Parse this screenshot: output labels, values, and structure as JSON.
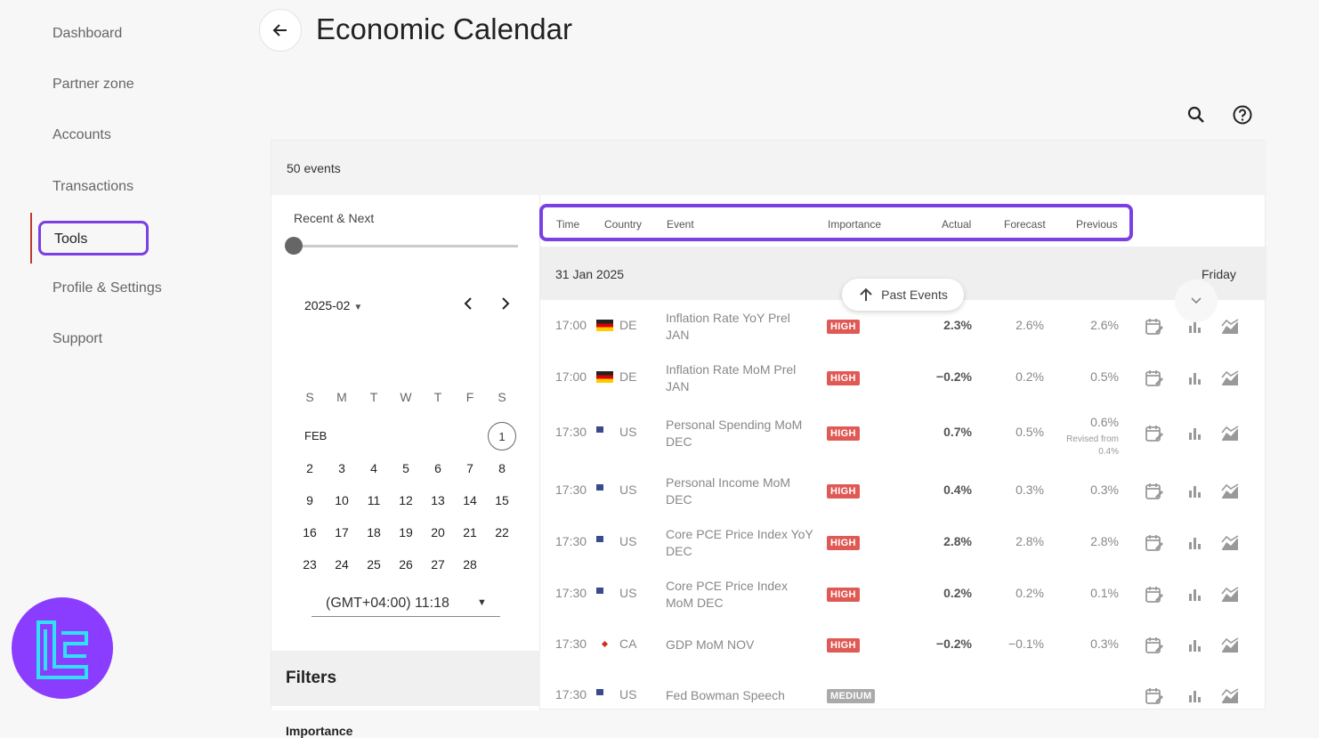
{
  "sidebar": {
    "items": [
      {
        "label": "Dashboard"
      },
      {
        "label": "Partner zone"
      },
      {
        "label": "Accounts"
      },
      {
        "label": "Transactions"
      },
      {
        "label": "Tools"
      },
      {
        "label": "Profile & Settings"
      },
      {
        "label": "Support"
      }
    ]
  },
  "header": {
    "title": "Economic Calendar"
  },
  "panel": {
    "events_count": "50 events",
    "range_label": "Recent & Next",
    "calendar": {
      "month_selector": "2025-02",
      "weekdays": [
        "S",
        "M",
        "T",
        "W",
        "T",
        "F",
        "S"
      ],
      "month_label": "FEB",
      "days": [
        "1",
        "2",
        "3",
        "4",
        "5",
        "6",
        "7",
        "8",
        "9",
        "10",
        "11",
        "12",
        "13",
        "14",
        "15",
        "16",
        "17",
        "18",
        "19",
        "20",
        "21",
        "22",
        "23",
        "24",
        "25",
        "26",
        "27",
        "28"
      ]
    },
    "timezone": "(GMT+04:00) 11:18",
    "filters_title": "Filters",
    "importance_label": "Importance"
  },
  "table": {
    "headers": {
      "time": "Time",
      "country": "Country",
      "event": "Event",
      "importance": "Importance",
      "actual": "Actual",
      "forecast": "Forecast",
      "previous": "Previous"
    },
    "date": "31 Jan 2025",
    "day": "Friday",
    "past_events_label": "Past Events",
    "rows": [
      {
        "time": "17:00",
        "flag": "de",
        "country": "DE",
        "event": "Inflation Rate YoY Prel JAN",
        "importance": "HIGH",
        "actual": "2.3%",
        "forecast": "2.6%",
        "previous": "2.6%",
        "revised": ""
      },
      {
        "time": "17:00",
        "flag": "de",
        "country": "DE",
        "event": "Inflation Rate MoM Prel JAN",
        "importance": "HIGH",
        "actual": "−0.2%",
        "forecast": "0.2%",
        "previous": "0.5%",
        "revised": ""
      },
      {
        "time": "17:30",
        "flag": "us",
        "country": "US",
        "event": "Personal Spending MoM DEC",
        "importance": "HIGH",
        "actual": "0.7%",
        "forecast": "0.5%",
        "previous": "0.6%",
        "revised": "Revised from 0.4%"
      },
      {
        "time": "17:30",
        "flag": "us",
        "country": "US",
        "event": "Personal Income MoM DEC",
        "importance": "HIGH",
        "actual": "0.4%",
        "forecast": "0.3%",
        "previous": "0.3%",
        "revised": ""
      },
      {
        "time": "17:30",
        "flag": "us",
        "country": "US",
        "event": "Core PCE Price Index YoY DEC",
        "importance": "HIGH",
        "actual": "2.8%",
        "forecast": "2.8%",
        "previous": "2.8%",
        "revised": ""
      },
      {
        "time": "17:30",
        "flag": "us",
        "country": "US",
        "event": "Core PCE Price Index MoM DEC",
        "importance": "HIGH",
        "actual": "0.2%",
        "forecast": "0.2%",
        "previous": "0.1%",
        "revised": ""
      },
      {
        "time": "17:30",
        "flag": "ca",
        "country": "CA",
        "event": "GDP MoM NOV",
        "importance": "HIGH",
        "actual": "−0.2%",
        "forecast": "−0.1%",
        "previous": "0.3%",
        "revised": ""
      },
      {
        "time": "17:30",
        "flag": "us",
        "country": "US",
        "event": "Fed Bowman Speech",
        "importance": "MEDIUM",
        "actual": "",
        "forecast": "",
        "previous": "",
        "revised": ""
      }
    ]
  },
  "colors": {
    "accent": "#7b3fe4",
    "high_badge": "#e05a55",
    "medium_badge": "#aaaaaa",
    "logo": "#8b3dff"
  }
}
